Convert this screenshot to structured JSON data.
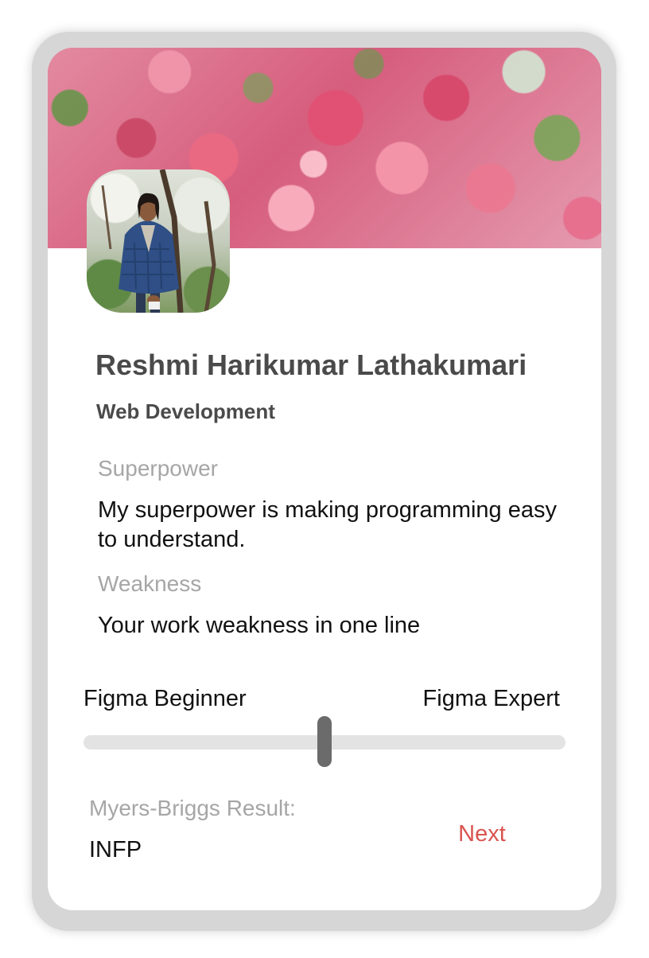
{
  "profile": {
    "name": "Reshmi Harikumar Lathakumari",
    "department": "Web Development"
  },
  "superpower": {
    "label": "Superpower",
    "text": "My superpower is making programming easy to understand."
  },
  "weakness": {
    "label": "Weakness",
    "text": "Your work weakness in one line"
  },
  "skill_slider": {
    "min_label": "Figma Beginner",
    "max_label": "Figma Expert",
    "value": 0.5
  },
  "personality": {
    "label": "Myers-Briggs Result:",
    "value": "INFP"
  },
  "actions": {
    "next_label": "Next"
  },
  "colors": {
    "accent": "#d9534f",
    "heading": "#4a4a4a",
    "muted": "#a6a6a6",
    "track": "#e3e3e3",
    "thumb": "#6b6b6b"
  }
}
